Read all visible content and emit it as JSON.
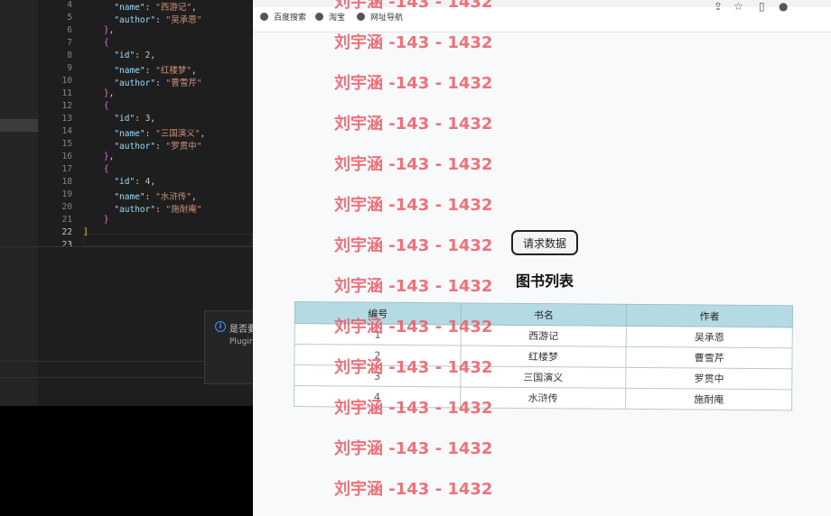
{
  "editor": {
    "line_numbers": [
      "4",
      "5",
      "6",
      "7",
      "8",
      "9",
      "10",
      "11",
      "12",
      "13",
      "14",
      "15",
      "16",
      "17",
      "18",
      "19",
      "20",
      "21",
      "22",
      "23"
    ],
    "lines": [
      [
        {
          "c": "k",
          "t": "      \"name\""
        },
        {
          "c": "p",
          "t": ": "
        },
        {
          "c": "s",
          "t": "\"西游记\""
        },
        {
          "c": "p",
          "t": ","
        }
      ],
      [
        {
          "c": "k",
          "t": "      \"author\""
        },
        {
          "c": "p",
          "t": ": "
        },
        {
          "c": "s",
          "t": "\"吴承恩\""
        }
      ],
      [
        {
          "c": "b1",
          "t": "    }"
        },
        {
          "c": "p",
          "t": ","
        }
      ],
      [
        {
          "c": "b1",
          "t": "    {"
        }
      ],
      [
        {
          "c": "k",
          "t": "      \"id\""
        },
        {
          "c": "p",
          "t": ": "
        },
        {
          "c": "n",
          "t": "2"
        },
        {
          "c": "p",
          "t": ","
        }
      ],
      [
        {
          "c": "k",
          "t": "      \"name\""
        },
        {
          "c": "p",
          "t": ": "
        },
        {
          "c": "s",
          "t": "\"红楼梦\""
        },
        {
          "c": "p",
          "t": ","
        }
      ],
      [
        {
          "c": "k",
          "t": "      \"author\""
        },
        {
          "c": "p",
          "t": ": "
        },
        {
          "c": "s",
          "t": "\"曹雪芹\""
        }
      ],
      [
        {
          "c": "b1",
          "t": "    }"
        },
        {
          "c": "p",
          "t": ","
        }
      ],
      [
        {
          "c": "b1",
          "t": "    {"
        }
      ],
      [
        {
          "c": "k",
          "t": "      \"id\""
        },
        {
          "c": "p",
          "t": ": "
        },
        {
          "c": "n",
          "t": "3"
        },
        {
          "c": "p",
          "t": ","
        }
      ],
      [
        {
          "c": "k",
          "t": "      \"name\""
        },
        {
          "c": "p",
          "t": ": "
        },
        {
          "c": "s",
          "t": "\"三国演义\""
        },
        {
          "c": "p",
          "t": ","
        }
      ],
      [
        {
          "c": "k",
          "t": "      \"author\""
        },
        {
          "c": "p",
          "t": ": "
        },
        {
          "c": "s",
          "t": "\"罗贯中\""
        }
      ],
      [
        {
          "c": "b1",
          "t": "    }"
        },
        {
          "c": "p",
          "t": ","
        }
      ],
      [
        {
          "c": "b1",
          "t": "    {"
        }
      ],
      [
        {
          "c": "k",
          "t": "      \"id\""
        },
        {
          "c": "p",
          "t": ": "
        },
        {
          "c": "n",
          "t": "4"
        },
        {
          "c": "p",
          "t": ","
        }
      ],
      [
        {
          "c": "k",
          "t": "      \"name\""
        },
        {
          "c": "p",
          "t": ": "
        },
        {
          "c": "s",
          "t": "\"水浒传\""
        },
        {
          "c": "p",
          "t": ","
        }
      ],
      [
        {
          "c": "k",
          "t": "      \"author\""
        },
        {
          "c": "p",
          "t": ": "
        },
        {
          "c": "s",
          "t": "\"施耐庵\""
        }
      ],
      [
        {
          "c": "b1",
          "t": "    }"
        }
      ],
      [
        {
          "c": "b2",
          "t": "]"
        }
      ],
      [
        {
          "c": "p",
          "t": ""
        }
      ]
    ]
  },
  "notification": {
    "text": "是否要",
    "source": "Plugin"
  },
  "browser": {
    "bookmarks": [
      "百度搜索",
      "淘宝",
      "网址导航"
    ],
    "fetch_button": "请求数据",
    "heading": "图书列表",
    "columns": [
      "编号",
      "书名",
      "作者"
    ],
    "rows": [
      {
        "id": "1",
        "name": "西游记",
        "author": "吴承恩"
      },
      {
        "id": "2",
        "name": "红楼梦",
        "author": "曹雪芹"
      },
      {
        "id": "3",
        "name": "三国演义",
        "author": "罗贯中"
      },
      {
        "id": "4",
        "name": "水浒传",
        "author": "施耐庵"
      }
    ]
  },
  "watermark": {
    "text": "刘宇涵 -143 - 1432",
    "count": 13
  },
  "colors": {
    "editor_bg": "#1e1e1e",
    "json_key": "#9cdcfe",
    "json_string": "#ce9178",
    "json_number": "#b5cea8",
    "table_header": "#b4dbe3",
    "watermark": "#eb5f69"
  }
}
